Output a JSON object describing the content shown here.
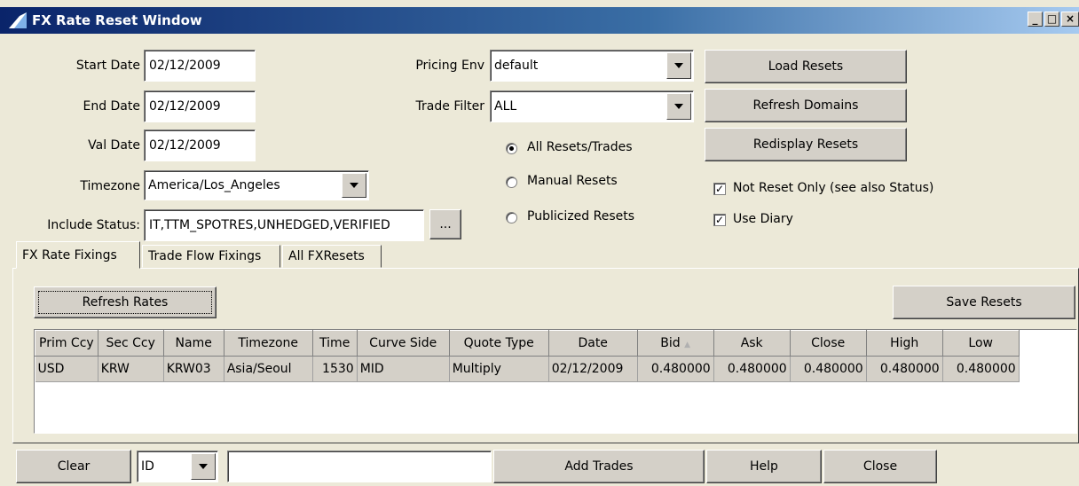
{
  "window": {
    "title": "FX Rate Reset Window",
    "minimize": "_",
    "maximize": "□",
    "close": "×"
  },
  "form": {
    "start_date": {
      "label": "Start Date",
      "value": "02/12/2009"
    },
    "end_date": {
      "label": "End Date",
      "value": "02/12/2009"
    },
    "val_date": {
      "label": "Val Date",
      "value": "02/12/2009"
    },
    "timezone": {
      "label": "Timezone",
      "value": "America/Los_Angeles"
    },
    "include_status": {
      "label": "Include Status:",
      "value": "IT,TTM_SPOTRES,UNHEDGED,VERIFIED",
      "browse": "..."
    },
    "pricing_env": {
      "label": "Pricing Env",
      "value": "default"
    },
    "trade_filter": {
      "label": "Trade Filter",
      "value": "ALL"
    },
    "radios": [
      {
        "label": "All Resets/Trades",
        "selected": true
      },
      {
        "label": "Manual Resets",
        "selected": false
      },
      {
        "label": "Publicized Resets",
        "selected": false
      }
    ],
    "buttons": {
      "load": "Load Resets",
      "refresh_domains": "Refresh Domains",
      "redisplay": "Redisplay Resets"
    },
    "checks": [
      {
        "label": "Not Reset Only (see also Status)",
        "checked": true
      },
      {
        "label": "Use Diary",
        "checked": true
      }
    ]
  },
  "tabs": [
    {
      "label": "FX Rate Fixings",
      "active": true
    },
    {
      "label": "Trade Flow Fixings",
      "active": false
    },
    {
      "label": "All FXResets",
      "active": false
    }
  ],
  "panel": {
    "refresh_rates": "Refresh Rates",
    "save_resets": "Save Resets",
    "columns": [
      "Prim Ccy",
      "Sec Ccy",
      "Name",
      "Timezone",
      "Time",
      "Curve Side",
      "Quote Type",
      "Date",
      "Bid",
      "Ask",
      "Close",
      "High",
      "Low"
    ],
    "rows": [
      [
        "USD",
        "KRW",
        "KRW03",
        "Asia/Seoul",
        "1530",
        "MID",
        "Multiply",
        "02/12/2009",
        "0.480000",
        "0.480000",
        "0.480000",
        "0.480000",
        "0.480000"
      ]
    ]
  },
  "bottom": {
    "clear": "Clear",
    "id_select": "ID",
    "search_value": "",
    "add_trades": "Add Trades",
    "help": "Help",
    "close": "Close"
  },
  "colors": {
    "title_start": "#0a246a",
    "title_end": "#a6caf0",
    "face": "#d4d0c8",
    "background": "#ece9d8"
  }
}
